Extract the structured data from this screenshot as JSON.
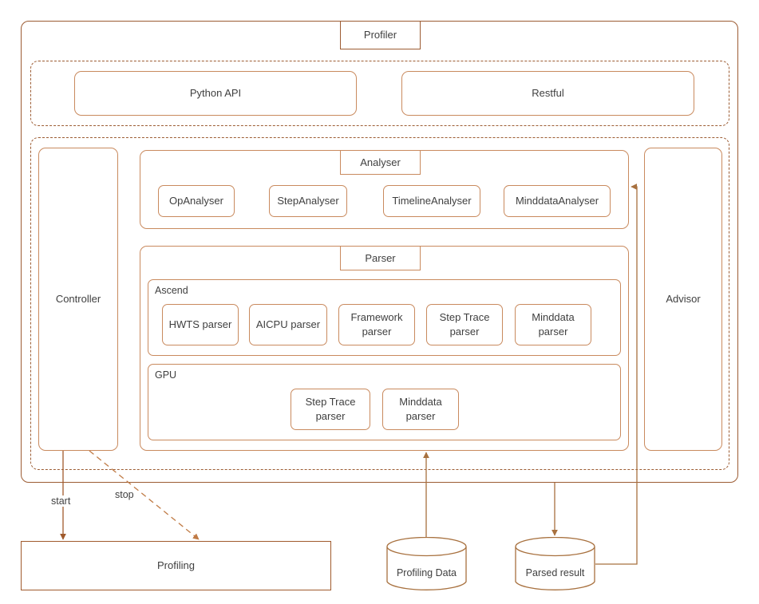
{
  "diagram": {
    "title": "Profiler",
    "colors": {
      "frame_strong": "#9c5c33",
      "component": "#c98a5e",
      "arrow": "#a05a2c",
      "text": "#3f3f3f",
      "background": "#ffffff"
    }
  },
  "api_layer": {
    "items": [
      {
        "label": "Python API"
      },
      {
        "label": "Restful"
      }
    ]
  },
  "core_layer": {
    "controller": {
      "label": "Controller"
    },
    "advisor": {
      "label": "Advisor"
    },
    "analyser": {
      "title": "Analyser",
      "items": [
        {
          "label": "OpAnalyser"
        },
        {
          "label": "StepAnalyser"
        },
        {
          "label": "TimelineAnalyser"
        },
        {
          "label": "MinddataAnalyser"
        }
      ]
    },
    "parser": {
      "title": "Parser",
      "groups": [
        {
          "label": "Ascend",
          "items": [
            {
              "label": "HWTS parser"
            },
            {
              "label": "AICPU parser"
            },
            {
              "label": "Framework\nparser"
            },
            {
              "label": "Step Trace\nparser"
            },
            {
              "label": "Minddata\nparser"
            }
          ]
        },
        {
          "label": "GPU",
          "items": [
            {
              "label": "Step Trace\nparser"
            },
            {
              "label": "Minddata\nparser"
            }
          ]
        }
      ]
    }
  },
  "external": {
    "profiling": {
      "label": "Profiling"
    },
    "profiling_data": {
      "label": "Profiling Data"
    },
    "parsed_result": {
      "label": "Parsed result"
    }
  },
  "edges": [
    {
      "label": "start",
      "from": "Controller",
      "to": "Profiling",
      "style": "solid"
    },
    {
      "label": "stop",
      "from": "Controller",
      "to": "Profiling",
      "style": "dashed"
    },
    {
      "label": "",
      "from": "Profiling Data",
      "to": "Parser",
      "style": "solid"
    },
    {
      "label": "",
      "from": "Parser",
      "to": "Parsed result",
      "style": "solid"
    },
    {
      "label": "",
      "from": "Parsed result",
      "to": "Analyser",
      "style": "solid"
    }
  ]
}
